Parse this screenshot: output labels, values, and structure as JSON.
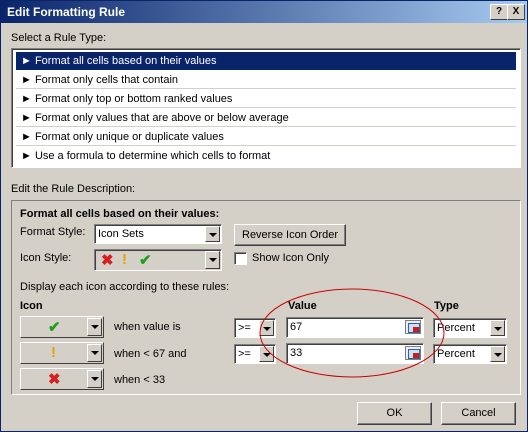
{
  "dialog": {
    "title": "Edit Formatting Rule",
    "help_label": "?",
    "close_label": "X",
    "select_rule_type_label": "Select a Rule Type:",
    "rule_types": [
      "► Format all cells based on their values",
      "► Format only cells that contain",
      "► Format only top or bottom ranked values",
      "► Format only values that are above or below average",
      "► Format only unique or duplicate values",
      "► Use a formula to determine which cells to format"
    ],
    "edit_description_label": "Edit the Rule Description:",
    "description_title": "Format all cells based on their values:",
    "format_style_label": "Format Style:",
    "format_style_value": "Icon Sets",
    "reverse_icon_order_label": "Reverse Icon Order",
    "icon_style_label": "Icon Style:",
    "show_icon_only_label": "Show Icon Only",
    "show_icon_only_checked": false,
    "display_rules_label": "Display each icon according to these rules:",
    "col_icon": "Icon",
    "col_value": "Value",
    "col_type": "Type",
    "rules": [
      {
        "icon": "green-check-icon",
        "condition": "when value is",
        "operator": ">=",
        "value": "67",
        "type": "Percent"
      },
      {
        "icon": "yellow-exclamation-icon",
        "condition": "when < 67 and",
        "operator": ">=",
        "value": "33",
        "type": "Percent"
      },
      {
        "icon": "red-cross-icon",
        "condition": "when < 33"
      }
    ],
    "ok_label": "OK",
    "cancel_label": "Cancel",
    "annotation_color": "#cc0000"
  }
}
